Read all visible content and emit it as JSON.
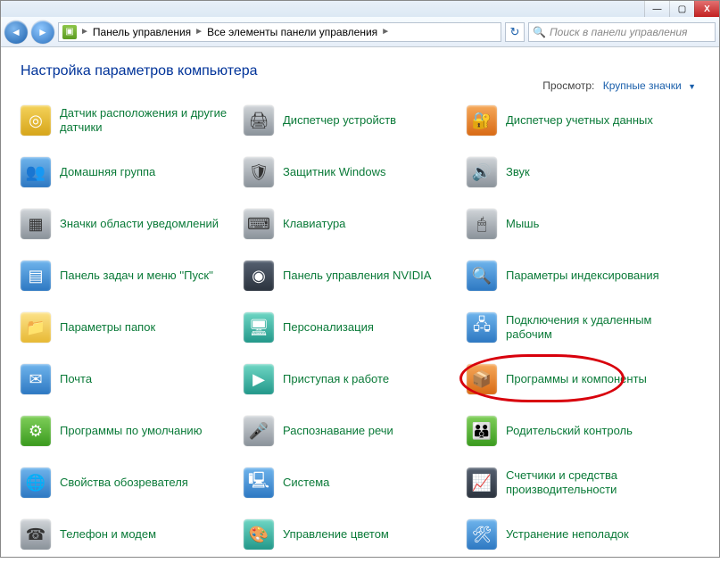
{
  "titlebar": {
    "minimize": "—",
    "maximize": "▢",
    "close": "X"
  },
  "nav": {
    "back": "◄",
    "forward": "►"
  },
  "breadcrumb": {
    "root_icon": "▣",
    "seg1": "Панель управления",
    "seg2": "Все элементы панели управления",
    "sep": "►",
    "refresh": "↻"
  },
  "search": {
    "placeholder": "Поиск в панели управления",
    "icon": "🔍"
  },
  "heading": "Настройка параметров компьютера",
  "view": {
    "label": "Просмотр:",
    "value": "Крупные значки",
    "caret": "▼"
  },
  "items": [
    {
      "label": "Датчик расположения и другие датчики",
      "icon": "◎",
      "cls": "ic-yellow",
      "name": "location-sensors"
    },
    {
      "label": "Диспетчер устройств",
      "icon": "🖨",
      "cls": "ic-gray",
      "name": "device-manager"
    },
    {
      "label": "Диспетчер учетных данных",
      "icon": "🔐",
      "cls": "ic-orange",
      "name": "credential-manager"
    },
    {
      "label": "Домашняя группа",
      "icon": "👥",
      "cls": "ic-blue",
      "name": "homegroup"
    },
    {
      "label": "Защитник Windows",
      "icon": "🛡",
      "cls": "ic-gray",
      "name": "windows-defender"
    },
    {
      "label": "Звук",
      "icon": "🔊",
      "cls": "ic-gray",
      "name": "sound"
    },
    {
      "label": "Значки области уведомлений",
      "icon": "▦",
      "cls": "ic-gray",
      "name": "notification-icons"
    },
    {
      "label": "Клавиатура",
      "icon": "⌨",
      "cls": "ic-gray",
      "name": "keyboard"
    },
    {
      "label": "Мышь",
      "icon": "🖱",
      "cls": "ic-gray",
      "name": "mouse"
    },
    {
      "label": "Панель задач и меню ''Пуск''",
      "icon": "▤",
      "cls": "ic-blue",
      "name": "taskbar-startmenu"
    },
    {
      "label": "Панель управления NVIDIA",
      "icon": "◉",
      "cls": "ic-dark",
      "name": "nvidia-control-panel"
    },
    {
      "label": "Параметры индексирования",
      "icon": "🔍",
      "cls": "ic-blue",
      "name": "indexing-options"
    },
    {
      "label": "Параметры папок",
      "icon": "📁",
      "cls": "ic-folder",
      "name": "folder-options"
    },
    {
      "label": "Персонализация",
      "icon": "🖥",
      "cls": "ic-teal",
      "name": "personalization"
    },
    {
      "label": "Подключения к удаленным рабочим",
      "icon": "🖧",
      "cls": "ic-blue",
      "name": "remote-app-connections"
    },
    {
      "label": "Почта",
      "icon": "✉",
      "cls": "ic-blue",
      "name": "mail"
    },
    {
      "label": "Приступая к работе",
      "icon": "▶",
      "cls": "ic-teal",
      "name": "getting-started"
    },
    {
      "label": "Программы и компоненты",
      "icon": "📦",
      "cls": "ic-orange",
      "name": "programs-and-features",
      "highlight": true
    },
    {
      "label": "Программы по умолчанию",
      "icon": "⚙",
      "cls": "ic-green",
      "name": "default-programs"
    },
    {
      "label": "Распознавание речи",
      "icon": "🎤",
      "cls": "ic-gray",
      "name": "speech-recognition"
    },
    {
      "label": "Родительский контроль",
      "icon": "👪",
      "cls": "ic-green",
      "name": "parental-controls"
    },
    {
      "label": "Свойства обозревателя",
      "icon": "🌐",
      "cls": "ic-blue",
      "name": "internet-options"
    },
    {
      "label": "Система",
      "icon": "🖳",
      "cls": "ic-blue",
      "name": "system"
    },
    {
      "label": "Счетчики и средства производительности",
      "icon": "📈",
      "cls": "ic-dark",
      "name": "performance-tools"
    },
    {
      "label": "Телефон и модем",
      "icon": "☎",
      "cls": "ic-gray",
      "name": "phone-modem"
    },
    {
      "label": "Управление цветом",
      "icon": "🎨",
      "cls": "ic-teal",
      "name": "color-management"
    },
    {
      "label": "Устранение неполадок",
      "icon": "🛠",
      "cls": "ic-blue",
      "name": "troubleshooting"
    }
  ]
}
